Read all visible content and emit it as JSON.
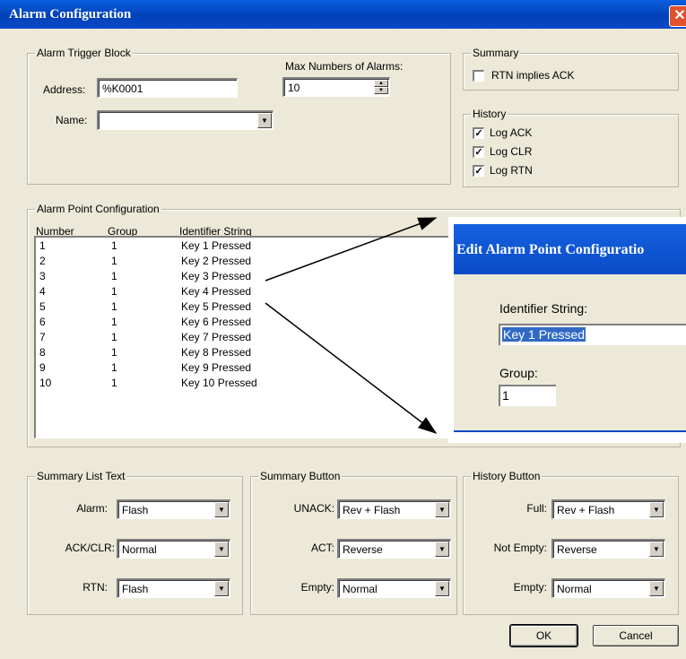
{
  "window": {
    "title": "Alarm Configuration"
  },
  "trigger": {
    "legend": "Alarm Trigger Block",
    "address_label": "Address:",
    "address_value": "%K0001",
    "max_label": "Max Numbers of Alarms:",
    "max_value": "10",
    "name_label": "Name:",
    "name_value": ""
  },
  "summary": {
    "legend": "Summary",
    "rtn_implies_ack": {
      "label": "RTN implies ACK",
      "checked": false
    }
  },
  "history": {
    "legend": "History",
    "log_ack": {
      "label": "Log ACK",
      "checked": true
    },
    "log_clr": {
      "label": "Log CLR",
      "checked": true
    },
    "log_rtn": {
      "label": "Log RTN",
      "checked": true
    }
  },
  "points": {
    "legend": "Alarm Point Configuration",
    "columns": [
      "Number",
      "Group",
      "Identifier String"
    ],
    "rows": [
      [
        "1",
        "1",
        "Key 1 Pressed"
      ],
      [
        "2",
        "1",
        "Key 2 Pressed"
      ],
      [
        "3",
        "1",
        "Key 3 Pressed"
      ],
      [
        "4",
        "1",
        "Key 4 Pressed"
      ],
      [
        "5",
        "1",
        "Key 5 Pressed"
      ],
      [
        "6",
        "1",
        "Key 6 Pressed"
      ],
      [
        "7",
        "1",
        "Key 7 Pressed"
      ],
      [
        "8",
        "1",
        "Key 8 Pressed"
      ],
      [
        "9",
        "1",
        "Key 9 Pressed"
      ],
      [
        "10",
        "1",
        "Key 10 Pressed"
      ]
    ]
  },
  "summary_list": {
    "legend": "Summary List Text",
    "alarm_label": "Alarm:",
    "alarm_value": "Flash",
    "ackclr_label": "ACK/CLR:",
    "ackclr_value": "Normal",
    "rtn_label": "RTN:",
    "rtn_value": "Flash"
  },
  "summary_button": {
    "legend": "Summary Button",
    "unack_label": "UNACK:",
    "unack_value": "Rev + Flash",
    "act_label": "ACT:",
    "act_value": "Reverse",
    "empty_label": "Empty:",
    "empty_value": "Normal"
  },
  "history_button": {
    "legend": "History Button",
    "full_label": "Full:",
    "full_value": "Rev + Flash",
    "notempty_label": "Not Empty:",
    "notempty_value": "Reverse",
    "empty_label": "Empty:",
    "empty_value": "Normal"
  },
  "buttons": {
    "ok": "OK",
    "cancel": "Cancel"
  },
  "edit_popup": {
    "title": "Edit Alarm Point Configuratio",
    "identifier_label": "Identifier String:",
    "identifier_value": "Key 1 Pressed",
    "group_label": "Group:",
    "group_value": "1"
  },
  "icons": {
    "close": "close-icon",
    "dropdown": "chevron-down-icon",
    "check": "checkmark-icon"
  },
  "colors": {
    "titlebar": "#0a49c8",
    "close": "#e0512c",
    "face": "#ece9d8",
    "selection": "#316ac5"
  }
}
